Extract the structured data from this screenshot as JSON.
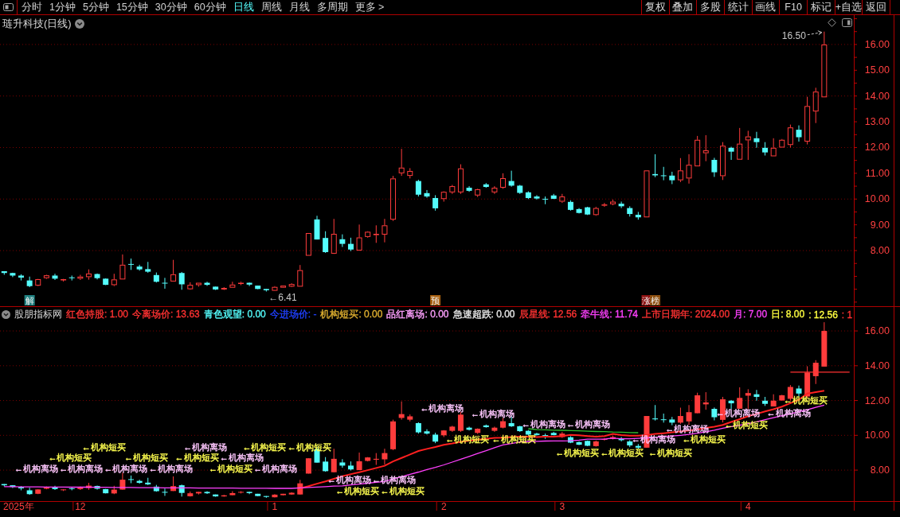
{
  "toolbar": {
    "tabs": [
      {
        "label": "分时",
        "selected": false
      },
      {
        "label": "1分钟",
        "selected": false
      },
      {
        "label": "5分钟",
        "selected": false
      },
      {
        "label": "15分钟",
        "selected": false
      },
      {
        "label": "30分钟",
        "selected": false
      },
      {
        "label": "60分钟",
        "selected": false
      },
      {
        "label": "日线",
        "selected": true
      },
      {
        "label": "周线",
        "selected": false
      },
      {
        "label": "月线",
        "selected": false
      },
      {
        "label": "多周期",
        "selected": false
      },
      {
        "label": "更多 >",
        "selected": false
      }
    ],
    "buttons": [
      "复权",
      "叠加",
      "多股",
      "统计",
      "画线",
      "F10",
      "标记",
      "+自选",
      "返回"
    ]
  },
  "chart": {
    "title": "琏升科技(日线)",
    "indicator_name": "股朋指标网",
    "legend": [
      {
        "text": "红色持股: 1.00",
        "color": "#ff3232"
      },
      {
        "text": "今离场价: 13.63",
        "color": "#ff3232"
      },
      {
        "text": "青色观望: 0.00",
        "color": "#54fcfc"
      },
      {
        "text": "今进场价: -",
        "color": "#2040ff"
      },
      {
        "text": "机构短买: 0.00",
        "color": "#e0b030"
      },
      {
        "text": "品红离场: 0.00",
        "color": "#ffa0ff"
      },
      {
        "text": "急速超跌: 0.00",
        "color": "#e8e8e8"
      },
      {
        "text": "辰星线: 12.56",
        "color": "#ff3232"
      },
      {
        "text": "牵牛线: 11.74",
        "color": "#ff40ff"
      },
      {
        "text": "上市日期年: 2024.00",
        "color": "#ff3232"
      },
      {
        "text": "月: 7.00",
        "color": "#ff40ff"
      },
      {
        "text": "日: 8.00",
        "color": "#ffff40"
      },
      {
        "text": ": 12.56",
        "color": "#ffff40"
      },
      {
        "text": ": 1",
        "color": "#ff3232"
      }
    ],
    "event_tags": [
      {
        "text": "解",
        "color": "#1f8080"
      },
      {
        "text": "预",
        "color": "#a86010"
      },
      {
        "text": "涨",
        "color": "#8c1010"
      },
      {
        "text": "榜",
        "color": "#8c5010"
      }
    ],
    "signals": [
      {
        "text": "←机构短买",
        "color": "#ffff50"
      },
      {
        "text": "←机构短买",
        "color": "#ffff50"
      },
      {
        "text": "←机构离场",
        "color": "#ffc8ff"
      },
      {
        "text": "←机构离场",
        "color": "#ffc8ff"
      },
      {
        "text": "←机构短买",
        "color": "#ffff50"
      },
      {
        "text": "←机构离场",
        "color": "#ffc8ff"
      },
      {
        "text": "←机构离场",
        "color": "#ffc8ff"
      },
      {
        "text": "←机构短买",
        "color": "#ffff50"
      },
      {
        "text": "←机构离场",
        "color": "#ffc8ff"
      },
      {
        "text": "←机构短买",
        "color": "#ffff50"
      },
      {
        "text": "←机构离场",
        "color": "#ffc8ff"
      },
      {
        "text": "←机构短买",
        "color": "#ffff50"
      },
      {
        "text": "←机构短买",
        "color": "#ffff50"
      },
      {
        "text": "←机构离场",
        "color": "#ffc8ff"
      },
      {
        "text": "←机构离场",
        "color": "#ffc8ff"
      },
      {
        "text": "←机构离场",
        "color": "#ffc8ff"
      },
      {
        "text": "←机构短买",
        "color": "#ffff50"
      },
      {
        "text": "←机构离场",
        "color": "#ffc8ff"
      },
      {
        "text": "←机构短买",
        "color": "#ffff50"
      },
      {
        "text": "←机构离场",
        "color": "#ffc8ff"
      },
      {
        "text": "←机构短买",
        "color": "#ffff50"
      },
      {
        "text": "←机构离场",
        "color": "#ffc8ff"
      },
      {
        "text": "←机构短买",
        "color": "#ffff50"
      },
      {
        "text": "←机构离场",
        "color": "#ffc8ff"
      },
      {
        "text": "←机构短买",
        "color": "#ffff50"
      },
      {
        "text": "←机构离场",
        "color": "#ffc8ff"
      },
      {
        "text": "←机构离场",
        "color": "#ffc8ff"
      },
      {
        "text": "←机构短买",
        "color": "#ffff50"
      },
      {
        "text": "←机构离场",
        "color": "#ffc8ff"
      },
      {
        "text": "←机构短买",
        "color": "#ffff50"
      },
      {
        "text": "←机构离场",
        "color": "#ffc8ff"
      },
      {
        "text": "←机构短买",
        "color": "#ffff50"
      },
      {
        "text": "←机构短买",
        "color": "#ffff50"
      },
      {
        "text": "←机构短买",
        "color": "#ffff50"
      }
    ],
    "chart_data": [
      {
        "type": "candlestick",
        "grid": true,
        "ylim": [
          5.84,
          17.14
        ],
        "yticks": [
          {
            "value": 8,
            "label": "8.00"
          },
          {
            "value": 9,
            "label": "9.00"
          },
          {
            "value": 10,
            "label": "10.00"
          },
          {
            "value": 11,
            "label": "11.00"
          },
          {
            "value": 12,
            "label": "12.00"
          },
          {
            "value": 13,
            "label": "13.00"
          },
          {
            "value": 14,
            "label": "14.00"
          },
          {
            "value": 15,
            "label": "15.00"
          },
          {
            "value": 16,
            "label": "16.00"
          }
        ],
        "ohlc": [
          [
            7.2,
            7.2,
            7.06,
            7.13
          ],
          [
            7.13,
            7.14,
            6.97,
            7.03
          ],
          [
            7.03,
            7.08,
            6.84,
            6.95
          ],
          [
            6.84,
            6.99,
            6.58,
            6.62
          ],
          [
            6.64,
            6.9,
            6.62,
            6.89
          ],
          [
            6.93,
            7.06,
            6.9,
            7.04
          ],
          [
            7.03,
            7.1,
            6.86,
            6.91
          ],
          [
            6.86,
            6.9,
            6.8,
            6.89
          ],
          [
            6.96,
            7.03,
            6.84,
            6.95
          ],
          [
            6.91,
            7.06,
            6.86,
            6.99
          ],
          [
            6.97,
            7.27,
            6.87,
            7.11
          ],
          [
            7.09,
            7.11,
            6.88,
            6.93
          ],
          [
            6.91,
            6.92,
            6.66,
            6.67
          ],
          [
            6.66,
            7.1,
            6.62,
            6.88
          ],
          [
            6.88,
            7.85,
            6.88,
            7.45
          ],
          [
            7.48,
            7.69,
            7.25,
            7.45
          ],
          [
            7.38,
            7.45,
            7.22,
            7.27
          ],
          [
            7.28,
            7.56,
            7.14,
            7.18
          ],
          [
            7.05,
            7.15,
            6.76,
            6.79
          ],
          [
            6.75,
            6.94,
            6.52,
            6.74
          ],
          [
            6.8,
            7.64,
            6.8,
            7.08
          ],
          [
            7.13,
            7.17,
            6.48,
            6.69
          ],
          [
            6.5,
            6.77,
            6.48,
            6.67
          ],
          [
            6.66,
            6.75,
            6.6,
            6.75
          ],
          [
            6.75,
            6.79,
            6.63,
            6.67
          ],
          [
            6.6,
            6.6,
            6.47,
            6.49
          ],
          [
            6.49,
            6.58,
            6.47,
            6.55
          ],
          [
            6.56,
            6.79,
            6.56,
            6.68
          ],
          [
            6.72,
            6.79,
            6.66,
            6.75
          ],
          [
            6.75,
            6.76,
            6.62,
            6.68
          ],
          [
            6.64,
            6.64,
            6.5,
            6.51
          ],
          [
            6.51,
            6.51,
            6.41,
            6.46
          ],
          [
            6.44,
            6.62,
            6.43,
            6.59
          ],
          [
            6.56,
            6.64,
            6.55,
            6.64
          ],
          [
            6.6,
            6.73,
            6.58,
            6.7
          ],
          [
            6.6,
            7.44,
            6.6,
            7.24
          ],
          [
            7.8,
            8.68,
            7.8,
            8.68
          ],
          [
            9.21,
            9.35,
            8.43,
            8.43
          ],
          [
            8.49,
            8.75,
            7.91,
            7.94
          ],
          [
            7.88,
            9.23,
            7.87,
            8.65
          ],
          [
            8.44,
            8.63,
            8.14,
            8.26
          ],
          [
            8.26,
            8.5,
            7.98,
            8.04
          ],
          [
            8.0,
            9.01,
            8.0,
            8.51
          ],
          [
            8.53,
            8.75,
            8.5,
            8.73
          ],
          [
            8.6,
            8.98,
            8.3,
            8.65
          ],
          [
            8.62,
            9.23,
            8.32,
            8.98
          ],
          [
            9.2,
            10.9,
            9.15,
            10.8
          ],
          [
            11.0,
            11.95,
            10.9,
            11.22
          ],
          [
            10.9,
            11.2,
            10.8,
            11.09
          ],
          [
            10.7,
            10.75,
            10.1,
            10.17
          ],
          [
            10.23,
            10.35,
            10.05,
            10.1
          ],
          [
            10.04,
            10.15,
            9.55,
            9.64
          ],
          [
            10.0,
            10.3,
            9.9,
            10.28
          ],
          [
            10.26,
            10.55,
            10.2,
            10.5
          ],
          [
            10.26,
            11.35,
            10.2,
            11.19
          ],
          [
            10.44,
            10.5,
            10.28,
            10.32
          ],
          [
            10.14,
            10.4,
            10.08,
            10.38
          ],
          [
            10.57,
            10.62,
            10.44,
            10.47
          ],
          [
            10.26,
            10.5,
            10.2,
            10.44
          ],
          [
            10.44,
            11.0,
            10.4,
            10.81
          ],
          [
            10.7,
            11.1,
            10.48,
            10.52
          ],
          [
            10.52,
            10.55,
            10.2,
            10.24
          ],
          [
            10.26,
            10.3,
            10.0,
            10.04
          ],
          [
            10.1,
            10.15,
            9.98,
            10.02
          ],
          [
            10.01,
            10.1,
            9.8,
            10.0
          ],
          [
            10.14,
            10.2,
            10.0,
            10.01
          ],
          [
            9.9,
            10.2,
            9.85,
            10.1
          ],
          [
            9.89,
            9.95,
            9.55,
            9.58
          ],
          [
            9.61,
            9.65,
            9.44,
            9.46
          ],
          [
            9.68,
            9.7,
            9.38,
            9.4
          ],
          [
            9.38,
            9.7,
            9.35,
            9.65
          ],
          [
            9.75,
            9.85,
            9.7,
            9.79
          ],
          [
            9.8,
            9.98,
            9.76,
            9.9
          ],
          [
            9.82,
            9.9,
            9.65,
            9.72
          ],
          [
            9.65,
            9.72,
            9.32,
            9.42
          ],
          [
            9.39,
            9.5,
            9.2,
            9.29
          ],
          [
            9.29,
            11.11,
            9.29,
            11.11
          ],
          [
            10.97,
            11.74,
            10.85,
            10.92
          ],
          [
            10.92,
            11.25,
            10.73,
            10.9
          ],
          [
            10.91,
            11.06,
            10.58,
            10.73
          ],
          [
            10.73,
            11.59,
            10.66,
            11.11
          ],
          [
            10.8,
            11.74,
            10.6,
            11.33
          ],
          [
            11.27,
            12.45,
            11.27,
            12.3
          ],
          [
            11.78,
            12.48,
            11.47,
            11.89
          ],
          [
            11.52,
            11.6,
            10.86,
            11.04
          ],
          [
            10.89,
            12.21,
            10.74,
            12.07
          ],
          [
            11.99,
            12.03,
            11.52,
            11.84
          ],
          [
            11.53,
            12.76,
            11.53,
            12.15
          ],
          [
            12.28,
            12.65,
            11.52,
            12.43
          ],
          [
            12.36,
            12.61,
            11.99,
            12.21
          ],
          [
            11.99,
            12.21,
            11.69,
            11.81
          ],
          [
            11.66,
            12.36,
            11.66,
            11.99
          ],
          [
            12.0,
            12.33,
            12.0,
            12.3
          ],
          [
            12.1,
            12.89,
            12.0,
            12.78
          ],
          [
            12.69,
            12.86,
            12.23,
            12.4
          ],
          [
            12.23,
            13.97,
            12.12,
            13.61
          ],
          [
            13.4,
            14.32,
            12.95,
            14.17
          ],
          [
            13.95,
            16.5,
            13.95,
            16.0
          ],
          null,
          null,
          null
        ],
        "annotations": [
          "16.50",
          "←6.41"
        ]
      },
      {
        "type": "candlestick",
        "grid": true,
        "ylim": [
          6.22,
          17.42
        ],
        "xlabel": "2025年",
        "categories": [
          null,
          null,
          null,
          null,
          null,
          null,
          null,
          null,
          null,
          "12",
          null,
          null,
          null,
          null,
          null,
          null,
          null,
          null,
          null,
          null,
          null,
          null,
          null,
          null,
          null,
          null,
          null,
          null,
          null,
          null,
          null,
          null,
          "1",
          null,
          null,
          null,
          null,
          null,
          null,
          null,
          null,
          null,
          null,
          null,
          null,
          null,
          null,
          null,
          null,
          null,
          null,
          null,
          "2",
          null,
          null,
          null,
          null,
          null,
          null,
          null,
          null,
          null,
          null,
          null,
          null,
          null,
          "3",
          null,
          null,
          null,
          null,
          null,
          null,
          null,
          null,
          null,
          null,
          null,
          null,
          null,
          null,
          null,
          null,
          null,
          null,
          null,
          null,
          null,
          "4",
          null,
          null,
          null,
          null,
          null,
          null,
          null,
          null,
          null,
          null,
          null,
          null
        ],
        "yticks": [
          {
            "value": 8,
            "label": "8.00"
          },
          {
            "value": 10,
            "label": "10.00"
          },
          {
            "value": 12,
            "label": "12.00"
          },
          {
            "value": 14,
            "label": "14.00"
          },
          {
            "value": 16,
            "label": "16.00"
          }
        ],
        "ohlc": [
          [
            7.2,
            7.2,
            7.06,
            7.13
          ],
          [
            7.13,
            7.14,
            6.97,
            7.03
          ],
          [
            7.03,
            7.08,
            6.84,
            6.95
          ],
          [
            6.84,
            6.99,
            6.58,
            6.62
          ],
          [
            6.64,
            6.9,
            6.62,
            6.89
          ],
          [
            6.93,
            7.06,
            6.9,
            7.04
          ],
          [
            7.03,
            7.1,
            6.86,
            6.91
          ],
          [
            6.86,
            6.9,
            6.8,
            6.89
          ],
          [
            6.96,
            7.03,
            6.84,
            6.95
          ],
          [
            6.91,
            7.06,
            6.86,
            6.99
          ],
          [
            6.97,
            7.27,
            6.87,
            7.11
          ],
          [
            7.09,
            7.11,
            6.88,
            6.93
          ],
          [
            6.91,
            6.92,
            6.66,
            6.67
          ],
          [
            6.66,
            7.1,
            6.62,
            6.88
          ],
          [
            6.88,
            7.85,
            6.88,
            7.45
          ],
          [
            7.48,
            7.69,
            7.25,
            7.45
          ],
          [
            7.38,
            7.45,
            7.22,
            7.27
          ],
          [
            7.28,
            7.56,
            7.14,
            7.18
          ],
          [
            7.05,
            7.15,
            6.76,
            6.79
          ],
          [
            6.75,
            6.94,
            6.52,
            6.74
          ],
          [
            6.8,
            7.64,
            6.8,
            7.08
          ],
          [
            7.13,
            7.17,
            6.48,
            6.69
          ],
          [
            6.5,
            6.77,
            6.48,
            6.67
          ],
          [
            6.66,
            6.75,
            6.6,
            6.75
          ],
          [
            6.75,
            6.79,
            6.63,
            6.67
          ],
          [
            6.6,
            6.6,
            6.47,
            6.49
          ],
          [
            6.49,
            6.58,
            6.47,
            6.55
          ],
          [
            6.56,
            6.79,
            6.56,
            6.68
          ],
          [
            6.72,
            6.79,
            6.66,
            6.75
          ],
          [
            6.75,
            6.76,
            6.62,
            6.68
          ],
          [
            6.64,
            6.64,
            6.5,
            6.51
          ],
          [
            6.51,
            6.51,
            6.41,
            6.46
          ],
          [
            6.44,
            6.62,
            6.43,
            6.59
          ],
          [
            6.56,
            6.64,
            6.55,
            6.64
          ],
          [
            6.6,
            6.73,
            6.58,
            6.7
          ],
          [
            6.6,
            7.44,
            6.6,
            7.24
          ],
          [
            7.8,
            8.68,
            7.8,
            8.68
          ],
          [
            9.21,
            9.35,
            8.43,
            8.43
          ],
          [
            8.49,
            8.75,
            7.91,
            7.94
          ],
          [
            7.88,
            9.23,
            7.87,
            8.65
          ],
          [
            8.44,
            8.63,
            8.14,
            8.26
          ],
          [
            8.26,
            8.5,
            7.98,
            8.04
          ],
          [
            8.0,
            9.01,
            8.0,
            8.51
          ],
          [
            8.53,
            8.75,
            8.5,
            8.73
          ],
          [
            8.6,
            8.98,
            8.3,
            8.65
          ],
          [
            8.62,
            9.23,
            8.32,
            8.98
          ],
          [
            9.2,
            10.9,
            9.15,
            10.8
          ],
          [
            11.0,
            11.95,
            10.9,
            11.22
          ],
          [
            10.9,
            11.2,
            10.8,
            11.09
          ],
          [
            10.7,
            10.75,
            10.1,
            10.17
          ],
          [
            10.23,
            10.35,
            10.05,
            10.1
          ],
          [
            10.04,
            10.15,
            9.55,
            9.64
          ],
          [
            10.0,
            10.3,
            9.9,
            10.28
          ],
          [
            10.26,
            10.55,
            10.2,
            10.5
          ],
          [
            10.26,
            11.35,
            10.2,
            11.19
          ],
          [
            10.44,
            10.5,
            10.28,
            10.32
          ],
          [
            10.14,
            10.4,
            10.08,
            10.38
          ],
          [
            10.57,
            10.62,
            10.44,
            10.47
          ],
          [
            10.26,
            10.5,
            10.2,
            10.44
          ],
          [
            10.44,
            11.0,
            10.4,
            10.81
          ],
          [
            10.7,
            11.1,
            10.48,
            10.52
          ],
          [
            10.52,
            10.55,
            10.2,
            10.24
          ],
          [
            10.26,
            10.3,
            10.0,
            10.04
          ],
          [
            10.1,
            10.15,
            9.98,
            10.02
          ],
          [
            10.01,
            10.1,
            9.8,
            10.0
          ],
          [
            10.14,
            10.2,
            10.0,
            10.01
          ],
          [
            9.9,
            10.2,
            9.85,
            10.1
          ],
          [
            9.89,
            9.95,
            9.55,
            9.58
          ],
          [
            9.61,
            9.65,
            9.44,
            9.46
          ],
          [
            9.68,
            9.7,
            9.38,
            9.4
          ],
          [
            9.38,
            9.7,
            9.35,
            9.65
          ],
          [
            9.75,
            9.85,
            9.7,
            9.79
          ],
          [
            9.8,
            9.98,
            9.76,
            9.9
          ],
          [
            9.82,
            9.9,
            9.65,
            9.72
          ],
          [
            9.65,
            9.72,
            9.32,
            9.42
          ],
          [
            9.39,
            9.5,
            9.2,
            9.29
          ],
          [
            9.29,
            11.11,
            9.29,
            11.11
          ],
          [
            10.97,
            11.74,
            10.85,
            10.92
          ],
          [
            10.92,
            11.25,
            10.73,
            10.9
          ],
          [
            10.91,
            11.06,
            10.58,
            10.73
          ],
          [
            10.73,
            11.59,
            10.66,
            11.11
          ],
          [
            10.8,
            11.74,
            10.6,
            11.33
          ],
          [
            11.27,
            12.45,
            11.27,
            12.3
          ],
          [
            11.78,
            12.48,
            11.47,
            11.89
          ],
          [
            11.52,
            11.6,
            10.86,
            11.04
          ],
          [
            10.89,
            12.21,
            10.74,
            12.07
          ],
          [
            11.99,
            12.03,
            11.52,
            11.84
          ],
          [
            11.53,
            12.76,
            11.53,
            12.15
          ],
          [
            12.28,
            12.65,
            11.52,
            12.43
          ],
          [
            12.36,
            12.61,
            11.99,
            12.21
          ],
          [
            11.99,
            12.21,
            11.69,
            11.81
          ],
          [
            11.66,
            12.36,
            11.66,
            11.99
          ],
          [
            12.0,
            12.33,
            12.0,
            12.3
          ],
          [
            12.1,
            12.89,
            12.0,
            12.78
          ],
          [
            12.69,
            12.86,
            12.23,
            12.4
          ],
          [
            12.23,
            13.97,
            12.12,
            13.61
          ],
          [
            13.4,
            14.32,
            12.95,
            14.17
          ],
          [
            13.95,
            16.5,
            13.95,
            16.0
          ],
          null,
          null,
          null
        ],
        "series": [
          {
            "type": "line",
            "color": "#ff2020",
            "values": [
              null,
              null,
              null,
              null,
              null,
              null,
              null,
              null,
              null,
              null,
              null,
              null,
              null,
              null,
              null,
              null,
              null,
              null,
              null,
              null,
              null,
              null,
              null,
              null,
              null,
              null,
              null,
              null,
              null,
              null,
              null,
              null,
              null,
              null,
              null,
              6.95,
              7.08,
              7.22,
              7.35,
              7.5,
              7.65,
              7.77,
              7.88,
              8.0,
              8.12,
              8.25,
              8.5,
              8.7,
              8.9,
              9.1,
              9.22,
              9.33,
              9.45,
              9.53,
              9.62,
              9.7,
              9.75,
              9.8,
              9.85,
              9.87,
              9.9,
              9.92,
              9.92,
              9.9,
              9.92,
              9.92,
              9.96,
              10.03,
              10.0,
              9.96,
              9.92,
              9.96,
              10.08,
              10.02,
              9.98,
              9.98,
              10.02,
              10.08,
              10.12,
              10.17,
              10.22,
              10.28,
              10.34,
              10.42,
              10.5,
              10.6,
              10.77,
              10.93,
              11.1,
              11.23,
              11.37,
              11.5,
              11.65,
              11.85,
              12.05,
              12.4,
              12.48,
              12.56,
              null,
              null,
              null
            ]
          },
          {
            "type": "line",
            "color": "#ff40ff",
            "values": [
              7.05,
              7.05,
              7.04,
              7.04,
              7.04,
              7.03,
              7.03,
              7.03,
              7.02,
              7.02,
              7.02,
              7.01,
              7.01,
              7.0,
              7.0,
              7.0,
              6.99,
              6.99,
              6.99,
              6.98,
              6.98,
              6.98,
              6.98,
              6.97,
              6.97,
              6.97,
              6.97,
              6.97,
              6.96,
              6.96,
              6.96,
              6.96,
              6.95,
              6.95,
              6.95,
              6.98,
              7.0,
              7.03,
              7.05,
              7.08,
              7.1,
              7.15,
              7.2,
              7.25,
              7.3,
              7.35,
              7.49,
              7.62,
              7.76,
              7.89,
              8.03,
              8.16,
              8.3,
              8.46,
              8.63,
              8.79,
              8.96,
              9.12,
              9.29,
              9.45,
              9.53,
              9.62,
              9.65,
              9.66,
              9.67,
              9.68,
              9.68,
              9.69,
              9.72,
              9.78,
              9.78,
              9.78,
              9.84,
              9.8,
              9.8,
              9.82,
              9.85,
              9.88,
              9.92,
              9.96,
              10.0,
              10.05,
              10.12,
              10.2,
              10.3,
              10.41,
              10.5,
              10.58,
              10.67,
              10.78,
              10.9,
              11.01,
              11.13,
              11.24,
              11.36,
              11.47,
              11.61,
              11.74,
              null,
              null,
              null
            ]
          },
          {
            "type": "line",
            "color": "#30c030",
            "values": [
              null,
              null,
              null,
              null,
              null,
              null,
              null,
              null,
              null,
              null,
              null,
              null,
              null,
              null,
              null,
              null,
              null,
              null,
              null,
              null,
              null,
              null,
              null,
              null,
              null,
              null,
              null,
              null,
              null,
              null,
              null,
              null,
              null,
              null,
              null,
              null,
              null,
              null,
              null,
              null,
              null,
              null,
              null,
              null,
              null,
              null,
              null,
              null,
              null,
              null,
              null,
              null,
              null,
              null,
              null,
              null,
              null,
              null,
              null,
              null,
              null,
              null,
              10.38,
              10.33,
              10.32,
              10.3,
              10.29,
              10.27,
              10.26,
              10.24,
              10.22,
              10.21,
              10.19,
              10.18,
              10.16,
              10.15,
              null,
              null,
              null,
              null,
              null,
              null,
              null,
              null,
              null,
              null,
              null,
              null,
              null,
              null,
              null,
              null,
              null,
              null,
              null,
              null,
              null,
              null,
              null,
              null,
              null
            ]
          },
          {
            "type": "line",
            "color": "#ff3232",
            "values": [
              null,
              null,
              null,
              null,
              null,
              null,
              null,
              null,
              null,
              null,
              null,
              null,
              null,
              null,
              null,
              null,
              null,
              null,
              null,
              null,
              null,
              null,
              null,
              null,
              null,
              null,
              null,
              null,
              null,
              null,
              null,
              null,
              null,
              null,
              null,
              null,
              null,
              null,
              null,
              null,
              null,
              null,
              null,
              null,
              null,
              null,
              null,
              null,
              null,
              null,
              null,
              null,
              null,
              null,
              null,
              null,
              null,
              null,
              null,
              null,
              null,
              null,
              null,
              null,
              null,
              null,
              null,
              null,
              null,
              null,
              null,
              null,
              null,
              null,
              null,
              null,
              null,
              null,
              null,
              null,
              null,
              null,
              null,
              null,
              null,
              null,
              null,
              null,
              null,
              null,
              null,
              null,
              null,
              13.63,
              13.63,
              13.63,
              13.63,
              13.63,
              13.63,
              13.63,
              13.63
            ]
          }
        ]
      }
    ]
  }
}
